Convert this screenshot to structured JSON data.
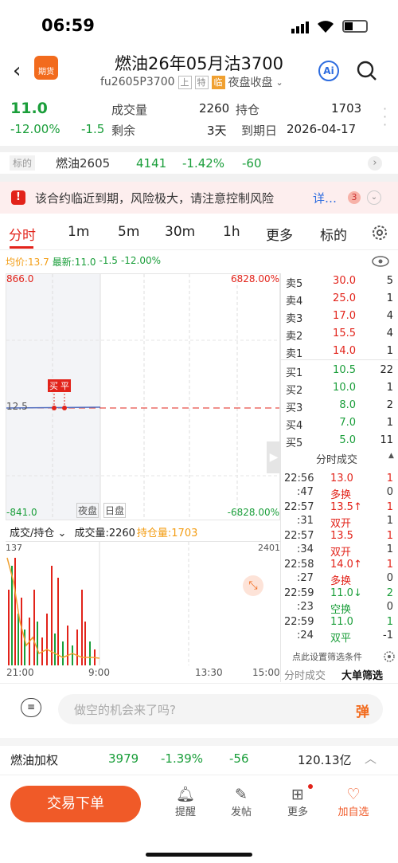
{
  "status": {
    "time": "06:59"
  },
  "header": {
    "title": "燃油26年05月沽3700",
    "code": "fu2605P3700",
    "tag1": "上",
    "tag2": "特",
    "tag3": "临",
    "session": "夜盘收盘",
    "logo_label": "期货",
    "ai_label": "Ai"
  },
  "quote": {
    "price": "11.0",
    "change_pct": "-12.00%",
    "change": "-1.5",
    "volume_label": "成交量",
    "volume": "2260",
    "oi_label": "持仓",
    "oi": "1703",
    "remain_label": "剩余",
    "remain": "3天",
    "expiry_label": "到期日",
    "expiry": "2026-04-17"
  },
  "underlying": {
    "label": "标的",
    "name": "燃油2605",
    "price": "4141",
    "pct": "-1.42%",
    "change": "-60"
  },
  "warning": {
    "text": "该合约临近到期，风险极大，请注意控制风险",
    "more": "详…",
    "count": "3"
  },
  "tabs": [
    "分时",
    "1m",
    "5m",
    "30m",
    "1h",
    "更多",
    "标的"
  ],
  "chart": {
    "avg_label": "均价:13.7",
    "latest_label": "最新:11.0",
    "change": "-1.5",
    "pct": "-12.00%",
    "top_left": "866.0",
    "top_right": "6828.00%",
    "bottom_left": "-841.0",
    "bottom_right": "-6828.00%",
    "mid_left": "12.5",
    "marker_buy": "买",
    "marker_close": "平",
    "night": "夜盘",
    "day": "日盘",
    "vol_selector": "成交/持仓",
    "vol_label": "成交量:2260",
    "oi_label": "持仓量:1703",
    "vol_left_max": "137",
    "vol_right_max": "2401",
    "times": [
      "21:00",
      "9:00",
      "13:30",
      "15:00"
    ]
  },
  "orderbook": {
    "asks": [
      {
        "l": "卖5",
        "p": "30.0",
        "v": "5"
      },
      {
        "l": "卖4",
        "p": "25.0",
        "v": "1"
      },
      {
        "l": "卖3",
        "p": "17.0",
        "v": "4"
      },
      {
        "l": "卖2",
        "p": "15.5",
        "v": "4"
      },
      {
        "l": "卖1",
        "p": "14.0",
        "v": "1"
      }
    ],
    "bids": [
      {
        "l": "买1",
        "p": "10.5",
        "v": "22"
      },
      {
        "l": "买2",
        "p": "10.0",
        "v": "1"
      },
      {
        "l": "买3",
        "p": "8.0",
        "v": "2"
      },
      {
        "l": "买4",
        "p": "7.0",
        "v": "1"
      },
      {
        "l": "买5",
        "p": "5.0",
        "v": "11"
      }
    ]
  },
  "ticks": {
    "title": "分时成交",
    "rows": [
      {
        "t": "22:56",
        "p": "13.0",
        "v": "1",
        "s": ":47",
        "k": "多换",
        "n": "0",
        "c": "red"
      },
      {
        "t": "22:57",
        "p": "13.5↑",
        "v": "1",
        "s": ":31",
        "k": "双开",
        "n": "1",
        "c": "red"
      },
      {
        "t": "22:57",
        "p": "13.5",
        "v": "1",
        "s": ":34",
        "k": "双开",
        "n": "1",
        "c": "red"
      },
      {
        "t": "22:58",
        "p": "14.0↑",
        "v": "1",
        "s": ":27",
        "k": "多换",
        "n": "0",
        "c": "red"
      },
      {
        "t": "22:59",
        "p": "11.0↓",
        "v": "2",
        "s": ":23",
        "k": "空换",
        "n": "0",
        "c": "green"
      },
      {
        "t": "22:59",
        "p": "11.0",
        "v": "1",
        "s": ":24",
        "k": "双平",
        "n": "-1",
        "c": "green"
      }
    ],
    "filter": "点此设置筛选条件",
    "tab1": "分时成交",
    "tab2": "大单筛选"
  },
  "input": {
    "placeholder": "做空的机会来了吗?",
    "danmu": "弹"
  },
  "ticker": {
    "name": "燃油加权",
    "price": "3979",
    "pct": "-1.39%",
    "change": "-56",
    "amount": "120.13亿"
  },
  "nav": {
    "trade": "交易下单",
    "items": [
      "提醒",
      "发帖",
      "更多",
      "加自选"
    ]
  }
}
